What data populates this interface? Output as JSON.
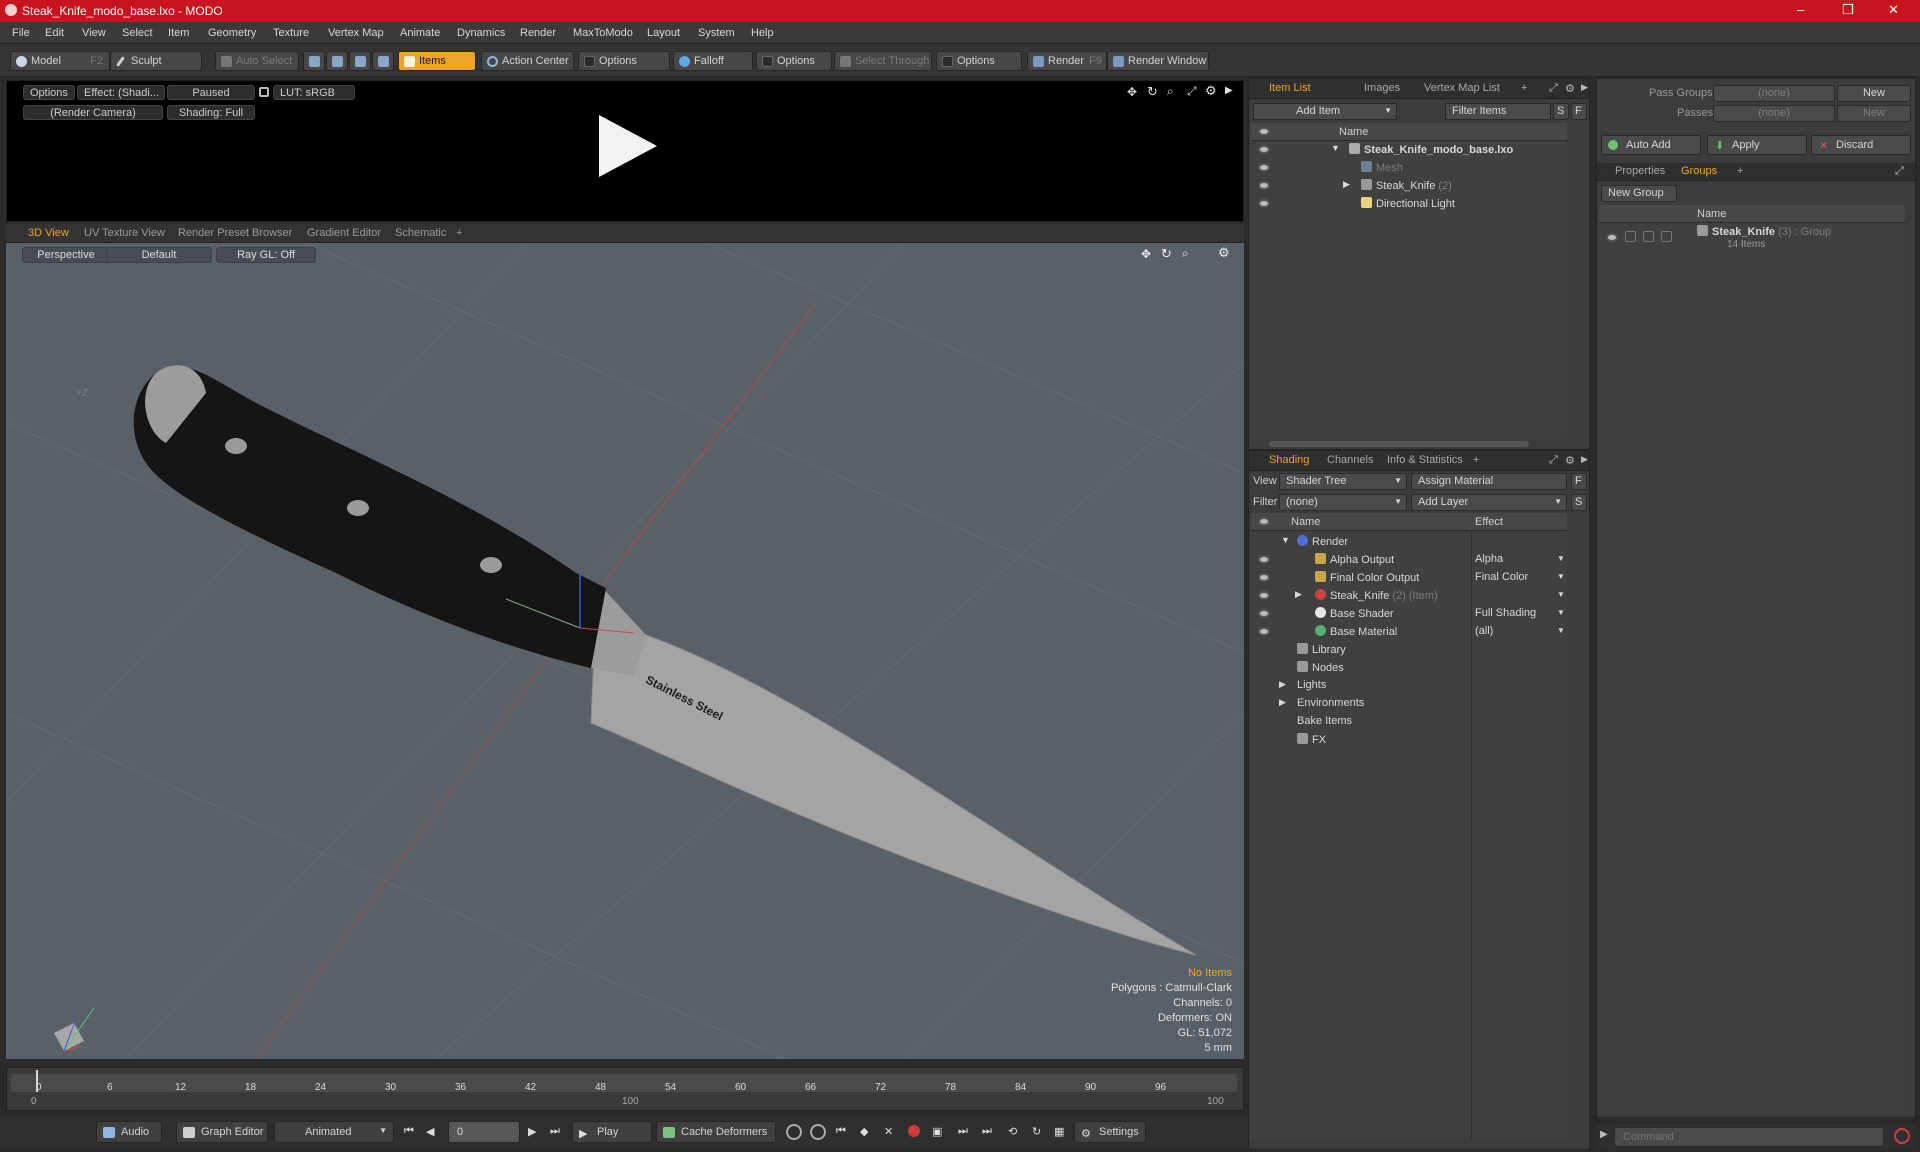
{
  "window": {
    "title": "Steak_Knife_modo_base.lxo - MODO",
    "minimize": "–",
    "maximize": "❐",
    "close": "✕"
  },
  "menu": [
    "File",
    "Edit",
    "View",
    "Select",
    "Item",
    "Geometry",
    "Texture",
    "Vertex Map",
    "Animate",
    "Dynamics",
    "Render",
    "MaxToModo",
    "Layout",
    "System",
    "Help"
  ],
  "toolbar": {
    "model": "Model",
    "model_key": "F2",
    "sculpt": "Sculpt",
    "auto_select": "Auto Select",
    "items": "Items",
    "action_center": "Action Center",
    "options1": "Options",
    "falloff": "Falloff",
    "options2": "Options",
    "select_through": "Select Through",
    "options3": "Options",
    "render": "Render",
    "render_key": "F9",
    "render_window": "Render Window"
  },
  "preview": {
    "options": "Options",
    "effect": "Effect: (Shadi...",
    "paused": "Paused",
    "lut": "LUT: sRGB",
    "camera": "(Render Camera)",
    "shading": "Shading: Full"
  },
  "viewport_tabs": [
    "3D View",
    "UV Texture View",
    "Render Preset Browser",
    "Gradient Editor",
    "Schematic",
    "+"
  ],
  "viewport": {
    "perspective": "Perspective",
    "default": "Default",
    "raygl": "Ray GL: Off",
    "axis_label": "+Z",
    "knife_text": "Stainless Steel",
    "hud": {
      "no_items": "No Items",
      "polygons": "Polygons : Catmull-Clark",
      "channels": "Channels: 0",
      "deformers": "Deformers: ON",
      "gl": "GL: 51,072",
      "unit": "5 mm"
    }
  },
  "timeline": {
    "ticks": [
      "0",
      "6",
      "12",
      "18",
      "24",
      "30",
      "36",
      "42",
      "48",
      "54",
      "60",
      "66",
      "72",
      "78",
      "84",
      "90",
      "96"
    ],
    "sub": [
      "0",
      "100",
      "100"
    ]
  },
  "bottom": {
    "audio": "Audio",
    "graph_editor": "Graph Editor",
    "animated": "Animated",
    "frame": "0",
    "play": "Play",
    "cache": "Cache Deformers",
    "settings": "Settings"
  },
  "item_list": {
    "tabs": [
      "Item List",
      "Images",
      "Vertex Map List",
      "+"
    ],
    "add_item": "Add Item",
    "filter": "Filter Items",
    "s": "S",
    "f": "F",
    "col_name": "Name",
    "rows": [
      {
        "label": "Steak_Knife_modo_base.lxo",
        "count": ""
      },
      {
        "label": "Mesh",
        "count": ""
      },
      {
        "label": "Steak_Knife",
        "count": "(2)"
      },
      {
        "label": "Directional Light",
        "count": ""
      }
    ]
  },
  "shading": {
    "tabs": [
      "Shading",
      "Channels",
      "Info & Statistics",
      "+"
    ],
    "view_label": "View",
    "view_value": "Shader Tree",
    "assign": "Assign Material",
    "filter_label": "Filter",
    "filter_value": "(none)",
    "add_layer": "Add Layer",
    "col_name": "Name",
    "col_effect": "Effect",
    "rows": [
      {
        "name": "Render",
        "effect": ""
      },
      {
        "name": "Alpha Output",
        "effect": "Alpha"
      },
      {
        "name": "Final Color Output",
        "effect": "Final Color"
      },
      {
        "name": "Steak_Knife",
        "extra": "(2) (Item)",
        "effect": ""
      },
      {
        "name": "Base Shader",
        "effect": "Full Shading"
      },
      {
        "name": "Base Material",
        "effect": "(all)"
      },
      {
        "name": "Library",
        "effect": ""
      },
      {
        "name": "Nodes",
        "effect": ""
      },
      {
        "name": "Lights",
        "effect": ""
      },
      {
        "name": "Environments",
        "effect": ""
      },
      {
        "name": "Bake Items",
        "effect": ""
      },
      {
        "name": "FX",
        "effect": ""
      }
    ]
  },
  "groups": {
    "pass_groups": "Pass Groups",
    "pass_value": "(none)",
    "new": "New",
    "passes": "Passes",
    "passes_value": "(none)",
    "new2": "New",
    "auto_add": "Auto Add",
    "apply": "Apply",
    "discard": "Discard",
    "tabs": [
      "Properties",
      "Groups",
      "+"
    ],
    "new_group": "New Group",
    "col_name": "Name",
    "group_name": "Steak_Knife",
    "group_meta": "(3) : Group",
    "group_items": "14 Items"
  },
  "command": {
    "placeholder": "Command"
  },
  "colors": {
    "accent": "#f0a329",
    "titlebar": "#c8141e"
  }
}
